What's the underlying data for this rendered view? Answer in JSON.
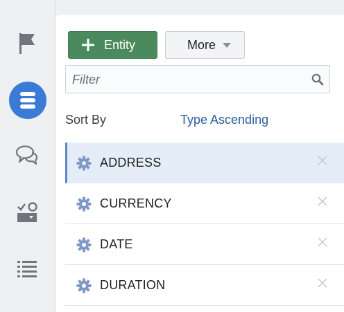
{
  "rail": {
    "items": [
      {
        "icon": "flag-icon"
      },
      {
        "icon": "database-icon",
        "active": true
      },
      {
        "icon": "chat-icon"
      },
      {
        "icon": "checklist-icon"
      },
      {
        "icon": "list-icon"
      }
    ]
  },
  "toolbar": {
    "entity_label": "Entity",
    "more_label": "More"
  },
  "filter": {
    "placeholder": "Filter"
  },
  "sort": {
    "label": "Sort By",
    "value": "Type Ascending"
  },
  "entities": [
    {
      "name": "ADDRESS",
      "selected": true
    },
    {
      "name": "CURRENCY"
    },
    {
      "name": "DATE"
    },
    {
      "name": "DURATION"
    }
  ],
  "colors": {
    "primary_green": "#4a8a5d",
    "rail_active": "#3a7bd5",
    "link_blue": "#2e5d9e",
    "selected_row": "#e5eef8"
  }
}
